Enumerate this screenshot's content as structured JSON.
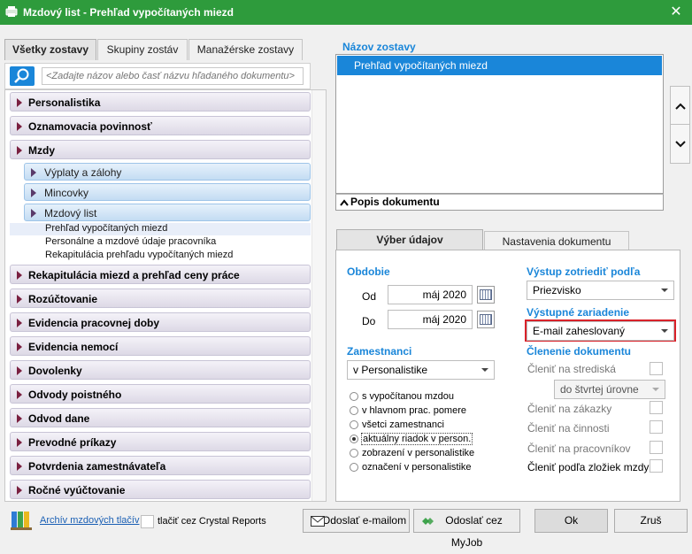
{
  "window": {
    "title": "Mzdový list - Prehľad vypočítaných miezd",
    "close_glyph": "✕"
  },
  "left_tabs": [
    "Všetky zostavy",
    "Skupiny zostáv",
    "Manažérske zostavy"
  ],
  "search": {
    "placeholder": "<Zadajte názov alebo časť názvu hľadaného dokumentu>"
  },
  "tree": {
    "groups_top": [
      "Personalistika",
      "Oznamovacia povinnosť",
      "Mzdy"
    ],
    "subgroups": [
      "Výplaty a zálohy",
      "Mincovky",
      "Mzdový list"
    ],
    "items": [
      "Prehľad vypočítaných miezd",
      "Personálne a mzdové údaje pracovníka",
      "Rekapitulácia prehľadu vypočítaných miezd"
    ],
    "groups_bottom": [
      "Rekapitulácia miezd a prehľad ceny práce",
      "Rozúčtovanie",
      "Evidencia pracovnej doby",
      "Evidencia nemocí",
      "Dovolenky",
      "Odvody poistného",
      "Odvod dane",
      "Prevodné príkazy",
      "Potvrdenia zamestnávateľa",
      "Ročné vyúčtovanie"
    ]
  },
  "report": {
    "caption": "Názov zostavy",
    "selected": "Prehľad vypočítaných miezd",
    "desc_toggle": "Popis dokumentu"
  },
  "nav": {
    "up_glyph": "⌃",
    "down_glyph": "⌄"
  },
  "right_tabs": [
    "Výber údajov",
    "Nastavenia dokumentu"
  ],
  "period": {
    "caption": "Obdobie",
    "from_label": "Od",
    "from_value": "máj 2020",
    "to_label": "Do",
    "to_value": "máj 2020"
  },
  "employees": {
    "caption": "Zamestnanci",
    "scope": "v Personalistike",
    "options": [
      "s vypočítanou mzdou",
      "v hlavnom prac. pomere",
      "všetci zamestnanci",
      "aktuálny riadok v person.",
      "zobrazení v personalistike",
      "označení v personalistike"
    ],
    "selected_index": 3
  },
  "output": {
    "sort_caption": "Výstup zotriediť podľa",
    "sort_value": "Priezvisko",
    "device_caption": "Výstupné zariadenie",
    "device_value": "E-mail zaheslovaný",
    "highlight_color": "#d9222a"
  },
  "split": {
    "caption": "Členenie dokumentu",
    "by_center": "Členiť na strediská",
    "level": "do štvrtej úrovne",
    "by_order": "Členiť na zákazky",
    "by_activity": "Členiť na činnosti",
    "by_worker": "Členiť na pracovníkov",
    "by_wage": "Členiť podľa zložiek mzdy"
  },
  "footer": {
    "archive_link": "Archív mzdových tlačív",
    "crystal_label": "tlačiť cez Crystal Reports",
    "email_btn": "Odoslať e-mailom",
    "myjob_btn": "Odoslať cez MyJob",
    "ok_btn": "Ok",
    "cancel_btn": "Zruš"
  },
  "colors": {
    "title_bar": "#2e9b3c",
    "accent": "#1a86d9"
  }
}
